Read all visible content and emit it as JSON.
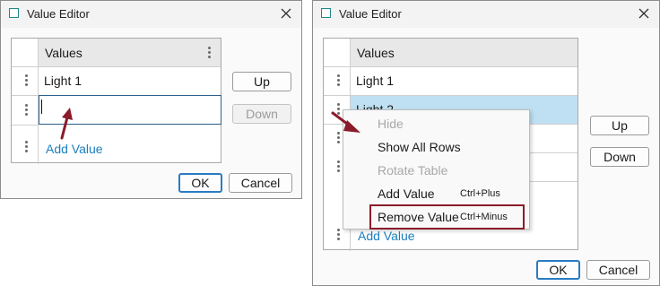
{
  "left_dialog": {
    "title": "Value Editor",
    "column_header": "Values",
    "rows": [
      {
        "value": "Light 1"
      },
      {
        "value": ""
      }
    ],
    "add_value_label": "Add Value",
    "up_label": "Up",
    "down_label": "Down",
    "ok_label": "OK",
    "cancel_label": "Cancel"
  },
  "right_dialog": {
    "title": "Value Editor",
    "column_header": "Values",
    "rows": [
      {
        "value": "Light 1"
      },
      {
        "value": "Light 2"
      }
    ],
    "add_value_label": "Add Value",
    "up_label": "Up",
    "down_label": "Down",
    "ok_label": "OK",
    "cancel_label": "Cancel",
    "context_menu": [
      {
        "label": "Hide",
        "shortcut": "",
        "enabled": false
      },
      {
        "label": "Show All Rows",
        "shortcut": "",
        "enabled": true
      },
      {
        "label": "Rotate Table",
        "shortcut": "",
        "enabled": false
      },
      {
        "label": "Add Value",
        "shortcut": "Ctrl+Plus",
        "enabled": true
      },
      {
        "label": "Remove Value",
        "shortcut": "Ctrl+Minus",
        "enabled": true,
        "emphasized": true
      }
    ]
  },
  "colors": {
    "accent": "#2a7bc4",
    "link": "#1a7fc0",
    "selected_row": "#bfe0f2",
    "annotation": "#8a1b2b",
    "app_icon": "#1f8a8a"
  },
  "icons": [
    "app-window-icon",
    "close-icon",
    "drag-handle-icon",
    "annotation-arrow-icon"
  ]
}
